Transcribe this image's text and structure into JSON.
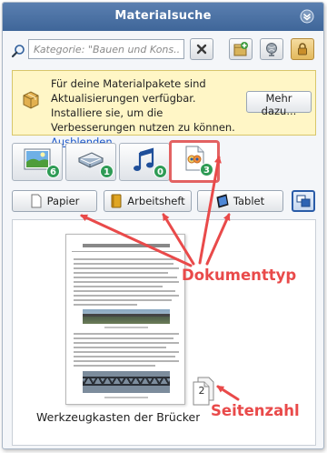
{
  "window": {
    "title": "Materialsuche"
  },
  "search": {
    "placeholder": "Kategorie: \"Bauen und Kons..."
  },
  "toolbar": {
    "icons": [
      "search-icon",
      "clear-icon",
      "add-package-icon",
      "globe-icon",
      "lock-icon"
    ]
  },
  "notice": {
    "message": "Für deine Materialpakete sind Aktualisierungen verfügbar. Installiere sie, um die Verbesserungen nutzen zu können.",
    "hide_link": "Ausblenden",
    "more_button": "Mehr dazu..."
  },
  "tabs": [
    {
      "icon": "image-icon",
      "count": "6",
      "active": false
    },
    {
      "icon": "book-icon",
      "count": "1",
      "active": false
    },
    {
      "icon": "music-note-icon",
      "count": "0",
      "active": false
    },
    {
      "icon": "document-icon",
      "count": "3",
      "active": true
    }
  ],
  "document_types": [
    {
      "label": "Papier",
      "icon": "paper-icon"
    },
    {
      "label": "Arbeitsheft",
      "icon": "workbook-icon"
    },
    {
      "label": "Tablet",
      "icon": "tablet-icon"
    }
  ],
  "preview": {
    "document_name": "Werkzeugkasten der Brückenb...",
    "page_count": "2"
  },
  "annotations": {
    "document_type": "Dokumenttyp",
    "page_number": "Seitenzahl"
  },
  "colors": {
    "accent": "#4a72a8",
    "annotation": "#e94a4a",
    "badge": "#2e9b55",
    "notice_bg": "#fff6c6"
  }
}
